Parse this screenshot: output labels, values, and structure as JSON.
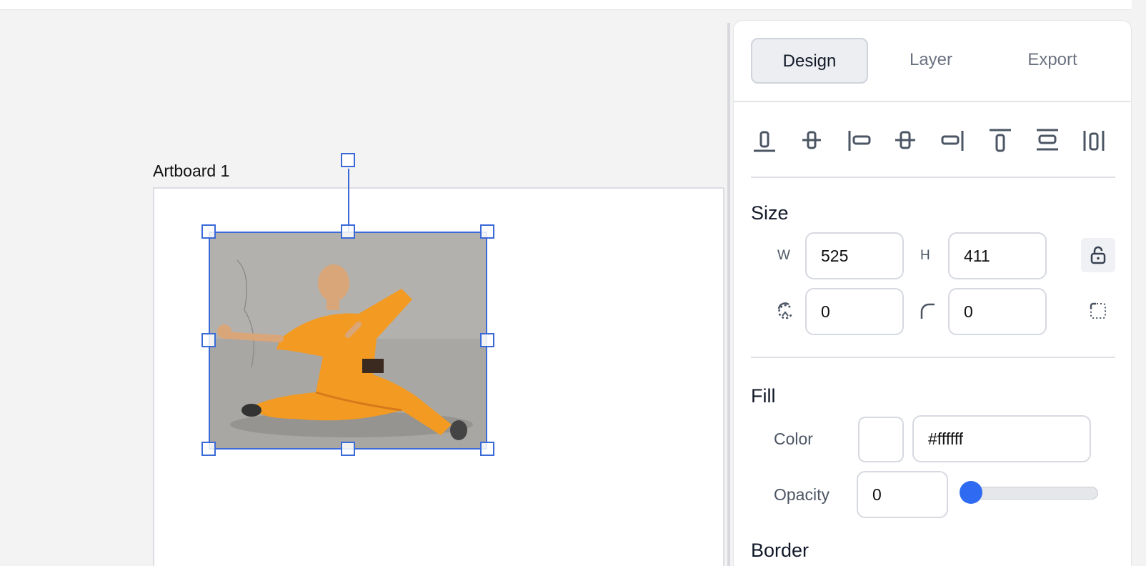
{
  "canvas": {
    "artboard_label": "Artboard 1",
    "image_description_name": "selected-photo"
  },
  "tabs": [
    {
      "label": "Design",
      "active": true
    },
    {
      "label": "Layer",
      "active": false
    },
    {
      "label": "Export",
      "active": false
    }
  ],
  "align_icons": [
    "align-bottom-icon",
    "align-vertical-center-icon",
    "align-left-icon",
    "align-horizontal-center-icon",
    "align-right-icon",
    "align-top-icon",
    "distribute-vertical-icon",
    "distribute-horizontal-icon"
  ],
  "size": {
    "title": "Size",
    "w_label": "W",
    "w_value": "525",
    "h_label": "H",
    "h_value": "411",
    "rotation_value": "0",
    "radius_value": "0"
  },
  "fill": {
    "title": "Fill",
    "color_label": "Color",
    "color_value": "#ffffff",
    "opacity_label": "Opacity",
    "opacity_value": "0",
    "opacity_fraction": 0
  },
  "border": {
    "title": "Border"
  },
  "colors": {
    "accent": "#2f6bf2",
    "selection": "#3a6ad8",
    "swatch": "#ffffff"
  }
}
